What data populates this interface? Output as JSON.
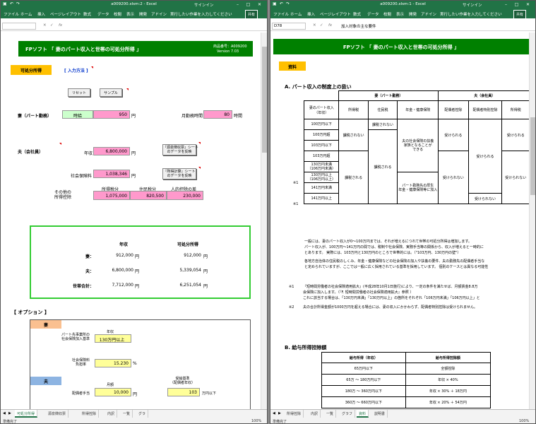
{
  "left": {
    "titlebar": {
      "title": "a009200.xlsm:2  -  Excel",
      "user": "サインイン"
    },
    "ribbon": {
      "tabs": [
        "ファイル",
        "ホーム",
        "挿入",
        "ページレイアウト",
        "数式",
        "データ",
        "校閲",
        "表示",
        "開発",
        "アドイン"
      ],
      "search": "実行したい作業を入力してください",
      "share": "共有"
    },
    "formula": {
      "namebox": "",
      "value": ""
    },
    "header": {
      "title": "FPソフト 「 妻のパート収入と世帯の可処分所得 」",
      "product_no": "商品番号：A009200",
      "version": "Version 7.03"
    },
    "section": {
      "label": "可処分所得",
      "link": "[ 入力方法 ]"
    },
    "buttons": {
      "reset": "リセット",
      "sample": "サンプル",
      "link1": "『源泉徴収票』シート\nのデータを反映",
      "link2": "『所得計算』シート\nのデータを反映"
    },
    "wife": {
      "label": "妻（パート勤務）",
      "type": "時給",
      "wage": "950",
      "yen": "円",
      "hours_label": "月勤務時間",
      "hours": "80",
      "hours_unit": "時間"
    },
    "husband": {
      "label": "夫（会社員）",
      "income_label": "年収",
      "income": "6,800,000",
      "yen": "円",
      "social_label": "社会保険料",
      "social": "1,038,346",
      "other_label": "その他の\n所得控除",
      "h_tax": "所得税分",
      "h_res": "住民税分",
      "h_personal": "人的控除の差",
      "v_tax": "1,075,000",
      "v_res": "820,500",
      "v_personal": "230,000"
    },
    "summary": {
      "h_income": "年収",
      "h_disp": "可処分所得",
      "rows": [
        {
          "label": "妻：",
          "income": "912,000",
          "disp": "912,000"
        },
        {
          "label": "夫：",
          "income": "6,800,000",
          "disp": "5,339,054"
        },
        {
          "label": "世帯合計：",
          "income": "7,712,000",
          "disp": "6,251,054"
        }
      ],
      "yen": "円"
    },
    "options": {
      "title": "【 オプション 】",
      "wife": "妻",
      "husband": "夫",
      "part_label": "パート先事業所の\n社会保険加入基準",
      "part_head": "年収",
      "part_value": "130万円以上",
      "burden_label": "社会保険料\n負担率",
      "burden": "15.230",
      "burden_unit": "%",
      "spouse_label": "配偶者手当",
      "spouse_head": "月額",
      "spouse": "10,000",
      "yen": "円",
      "criteria_head": "受給基準\n（配偶者年収）",
      "criteria": "103",
      "criteria_unit": "万円以下"
    },
    "tabs": [
      "可処分所得",
      "源泉徴収票",
      "所得控除",
      "内訳",
      "一覧",
      "グラ"
    ],
    "status": {
      "ready": "準備完了",
      "zoom": "100%"
    }
  },
  "right": {
    "titlebar": {
      "title": "a009200.xlsm:1  -  Excel",
      "user": "サインイン"
    },
    "ribbon": {
      "tabs": [
        "ファイル",
        "ホーム",
        "挿入",
        "ページレイアウト",
        "数式",
        "データ",
        "校閲",
        "表示",
        "開発",
        "アドイン"
      ],
      "search": "実行したい作業を入力してください",
      "share": "共有"
    },
    "formula": {
      "namebox": "D78",
      "value": "加入対象の主な要件"
    },
    "header": {
      "title": "FPソフト 「 妻のパート収入と世帯の可処分所得 」"
    },
    "section": {
      "label": "資料"
    },
    "secA": "A.  パート収入の制度上の扱い",
    "tableA": {
      "wife_head": "妻（パート勤務）",
      "husband_head": "夫（会社員）",
      "col_income": "妻のパート収入\n（年収）",
      "col_itax": "所得税",
      "col_rtax": "住民税",
      "col_pension": "年金・健康保険",
      "col_h_itax": "所得税",
      "col_h_rtax": "住民税",
      "col_spouse": "配偶者控除",
      "col_special": "配偶者特別控除",
      "rows": [
        "100万円以下",
        "100万円超",
        "103万円以下",
        "103万円超",
        "130万円未満\n（106万円未満）",
        "130万円以上\n（106万円以上）",
        "141万円未満",
        "141万円以上"
      ],
      "nontax": "課税されない",
      "taxed": "課税される",
      "pension_a": "夫の社会保険の扶養\n家族となることが\nできる",
      "pension_b": "パート勤務先の厚生\n年金・健康保険等に加入",
      "receive": "受けられる",
      "not_receive": "受けられない",
      "note1": "※1",
      "note2": "※1"
    },
    "paraA": [
      "一般には、妻のパート収入が0〜100万円までは、それが増えるにつれて世帯の可処分所得は増加します。",
      "パート収入が、100万円〜141万円の間では、税制や社会保険、実務手当等の関係から、収入が増えると一時的に",
      "とあります。 実際には、103万円と130万円のところで世帯的には。（\"103万円、130万円の壁\"）",
      "各地方自治体の住民税のしくみ、年金・健康保険などの社会保険の加入や扶養の要件、夫の勤務先の配偶者手当な",
      "と定められていますが、ここでは一般に広く採用されている基準を採用しています。 個別のケースとは異なる可能性"
    ],
    "noteList": [
      {
        "mark": "※1",
        "text": "『短時間労働者の社会保険適用拡大』(平成28年10月1日施行)により、一定の条件を満たせば、月額賃金8.8万",
        "text2": "会保険に加入します。（『F. 短時間労働者の社会保険適用拡大』参照 ）",
        "text3": "これに該当する場合は、「130万円未満」「130万円以上」の箇所をそれぞれ「106万円未満」「106万円以上」と"
      },
      {
        "mark": "※2",
        "text": "夫の合計所得金額が1000万円を超える場合には、妻の収入にかかわらず、配偶者特別控除は受けられません。"
      }
    ],
    "secB": "B.  給与所得控除額",
    "tableB": {
      "h1": "給与所得（年収）",
      "h2": "給与所得控除額",
      "rows": [
        [
          "65万円以下",
          "全額控除"
        ],
        [
          "65万 〜 180万円以下",
          "年収 × 40%"
        ],
        [
          "180万 〜 360万円以下",
          "年収 × 30% ＋ 18万円"
        ],
        [
          "360万 〜 660万円以下",
          "年収 × 20% ＋ 54万円"
        ]
      ]
    },
    "tabs": [
      "所得控除",
      "内訳",
      "一覧",
      "グラフ",
      "資料",
      "説明書"
    ],
    "status": {
      "ready": "準備完了",
      "zoom": "100%"
    }
  }
}
